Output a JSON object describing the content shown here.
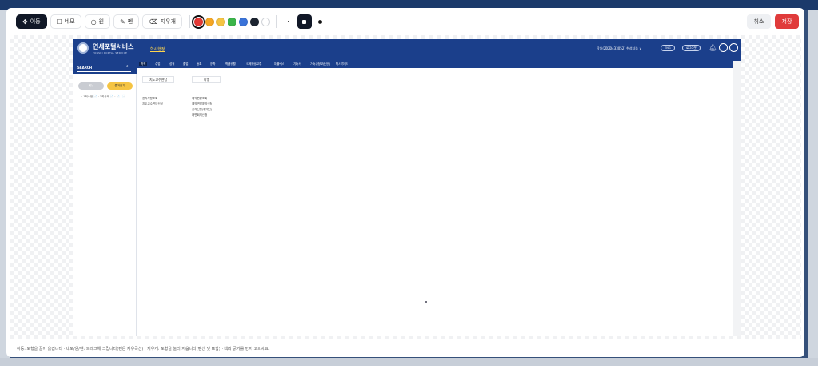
{
  "toolbar": {
    "tools": [
      {
        "label": "이동",
        "icon": "move-arrows-icon",
        "active": true
      },
      {
        "label": "네모",
        "icon": "square-icon",
        "active": false
      },
      {
        "label": "원",
        "icon": "circle-icon",
        "active": false
      },
      {
        "label": "펜",
        "icon": "pen-icon",
        "active": false
      },
      {
        "label": "지우개",
        "icon": "eraser-icon",
        "active": false
      }
    ],
    "colors": [
      "#e53935",
      "#f5a623",
      "#f5c443",
      "#3bb54a",
      "#3a73d9",
      "#1c2430",
      "#ffffff"
    ],
    "selected_color": "#e53935",
    "sizes": [
      "small",
      "medium",
      "large"
    ],
    "selected_size": "medium",
    "cancel_label": "취소",
    "save_label": "저장"
  },
  "captured_page": {
    "site_title": "연세포털서비스",
    "site_subtitle": "YONSEI PORTAL SERVICE",
    "active_tab": "학사행정",
    "user_info": "학생(2020433052) 한성지능 ∨",
    "pills": [
      "ENG",
      "로그아웃"
    ],
    "search_label": "SEARCH",
    "side_buttons": [
      "메뉴",
      "즐겨찾기"
    ],
    "side_links": "· 1회수정 📄 · 1회삭제 📄 · 📄 · 📄",
    "nav_items": [
      "학적",
      "수업",
      "성적",
      "졸업",
      "등록",
      "장학",
      "학생생활",
      "국제학생교류",
      "채플어스",
      "기숙사",
      "기숙사정보(신관)",
      "학사가이드"
    ],
    "menu_columns": [
      {
        "header": "지도교수면담",
        "links": [
          "공지사항조회",
          "지도교수면담신청"
        ]
      },
      {
        "header": "학생",
        "links": [
          "예약현황조회",
          "예약면담예약신청",
          "공지신청(예약전)",
          "대면회의신청"
        ]
      }
    ]
  },
  "status_text": "이동: 도형을 끌어 옮깁니다 · 네모/원/펜: 드래그해 그립니다(펜은 자유곡선) · 지우개: 도형을 눌러 지웁니다(펜선 및 포함) · 색과 굵기를 먼저 고르세요."
}
